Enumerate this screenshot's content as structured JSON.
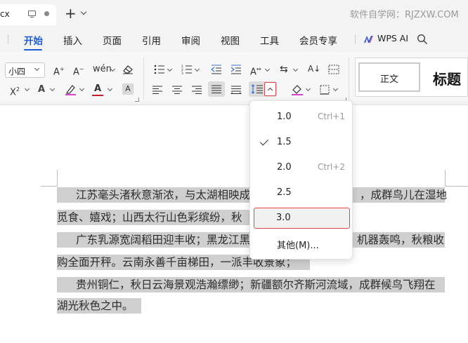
{
  "titlebar": {
    "doc_tab_name": "cx",
    "watermark": "软件自学网：RJZXW.COM"
  },
  "menu": {
    "tabs": [
      "开始",
      "插入",
      "页面",
      "引用",
      "审阅",
      "视图",
      "工具",
      "会员专享"
    ],
    "active_tab": "开始",
    "wps_ai_label": "WPS AI"
  },
  "ribbon": {
    "font_size_value": "小四",
    "styles": {
      "normal": "正文",
      "heading": "标题"
    }
  },
  "line_spacing_menu": {
    "items": [
      {
        "label": "1.0",
        "shortcut": "Ctrl+1",
        "checked": false
      },
      {
        "label": "1.5",
        "shortcut": "",
        "checked": true
      },
      {
        "label": "2.0",
        "shortcut": "Ctrl+2",
        "checked": false
      },
      {
        "label": "2.5",
        "shortcut": "",
        "checked": false
      },
      {
        "label": "3.0",
        "shortcut": "",
        "checked": false,
        "highlighted": true
      },
      {
        "label": "其他(M)...",
        "shortcut": "",
        "checked": false
      }
    ]
  },
  "document": {
    "lines": [
      {
        "left": "江苏毫头渚秋意渐浓，与太湖相映成",
        "right": "，成群鸟儿在湿地"
      },
      {
        "left": "觅食、嬉戏；山西太行山色彩缤纷，秋",
        "right": ""
      },
      {
        "left": "广东乳源宽阔稻田迎丰收；黑龙江黑",
        "right": "机器轰鸣，秋粮收"
      },
      {
        "left": "购全面开秤。云南永善千亩梯田，一派丰收景象；",
        "right": ""
      },
      {
        "left": "贵州铜仁，秋日云海景观浩瀚缥缈；新疆额尔齐斯河流域，成群候鸟飞翔在",
        "right": ""
      },
      {
        "left": "湖光秋色之中。",
        "right": ""
      }
    ]
  },
  "colors": {
    "accent": "#1a5fd6",
    "highlight_border": "#e04848",
    "selection": "#cfcfcf"
  }
}
